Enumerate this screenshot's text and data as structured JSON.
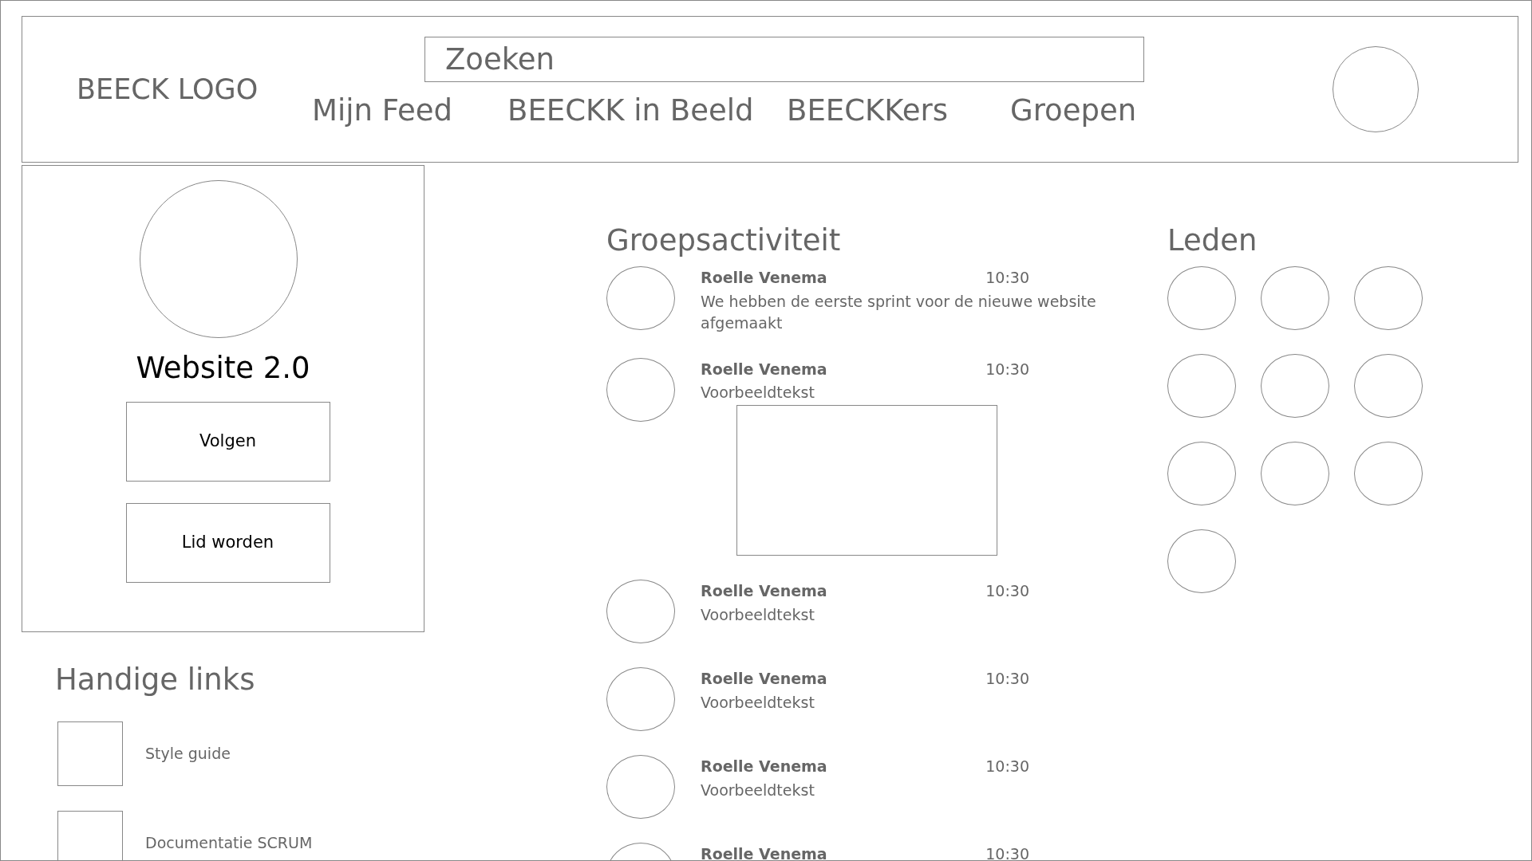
{
  "header": {
    "logo": "BEECK LOGO",
    "search": {
      "placeholder": "Zoeken"
    },
    "nav": [
      {
        "label": "Mijn Feed"
      },
      {
        "label": "BEECKK in Beeld"
      },
      {
        "label": "BEECKKers"
      },
      {
        "label": "Groepen"
      }
    ]
  },
  "group": {
    "title": "Website 2.0",
    "buttons": [
      "Volgen",
      "Lid worden"
    ]
  },
  "links": {
    "title": "Handige links",
    "items": [
      {
        "label": "Style guide"
      },
      {
        "label": "Documentatie SCRUM"
      }
    ]
  },
  "activity": {
    "title": "Groepsactiviteit",
    "posts": [
      {
        "kind": "text",
        "author": "Roelle Venema",
        "time": "10:30",
        "text": "We hebben de eerste sprint voor de nieuwe website afgemaakt"
      },
      {
        "kind": "image",
        "author": "Roelle Venema",
        "time": "10:30",
        "text": "Voorbeeldtekst"
      },
      {
        "kind": "text",
        "author": "Roelle Venema",
        "time": "10:30",
        "text": "Voorbeeldtekst"
      },
      {
        "kind": "text",
        "author": "Roelle Venema",
        "time": "10:30",
        "text": "Voorbeeldtekst"
      },
      {
        "kind": "text",
        "author": "Roelle Venema",
        "time": "10:30",
        "text": "Voorbeeldtekst"
      },
      {
        "kind": "text",
        "author": "Roelle Venema",
        "time": "10:30"
      }
    ]
  },
  "members": {
    "title": "Leden",
    "items": [
      {
        "kind": "avatar"
      },
      {
        "kind": "avatar"
      },
      {
        "kind": "avatar"
      },
      {
        "kind": "avatar"
      },
      {
        "kind": "avatar"
      },
      {
        "kind": "avatar"
      },
      {
        "kind": "avatar"
      },
      {
        "kind": "avatar"
      },
      {
        "kind": "avatar"
      },
      {
        "kind": "avatar"
      }
    ]
  }
}
